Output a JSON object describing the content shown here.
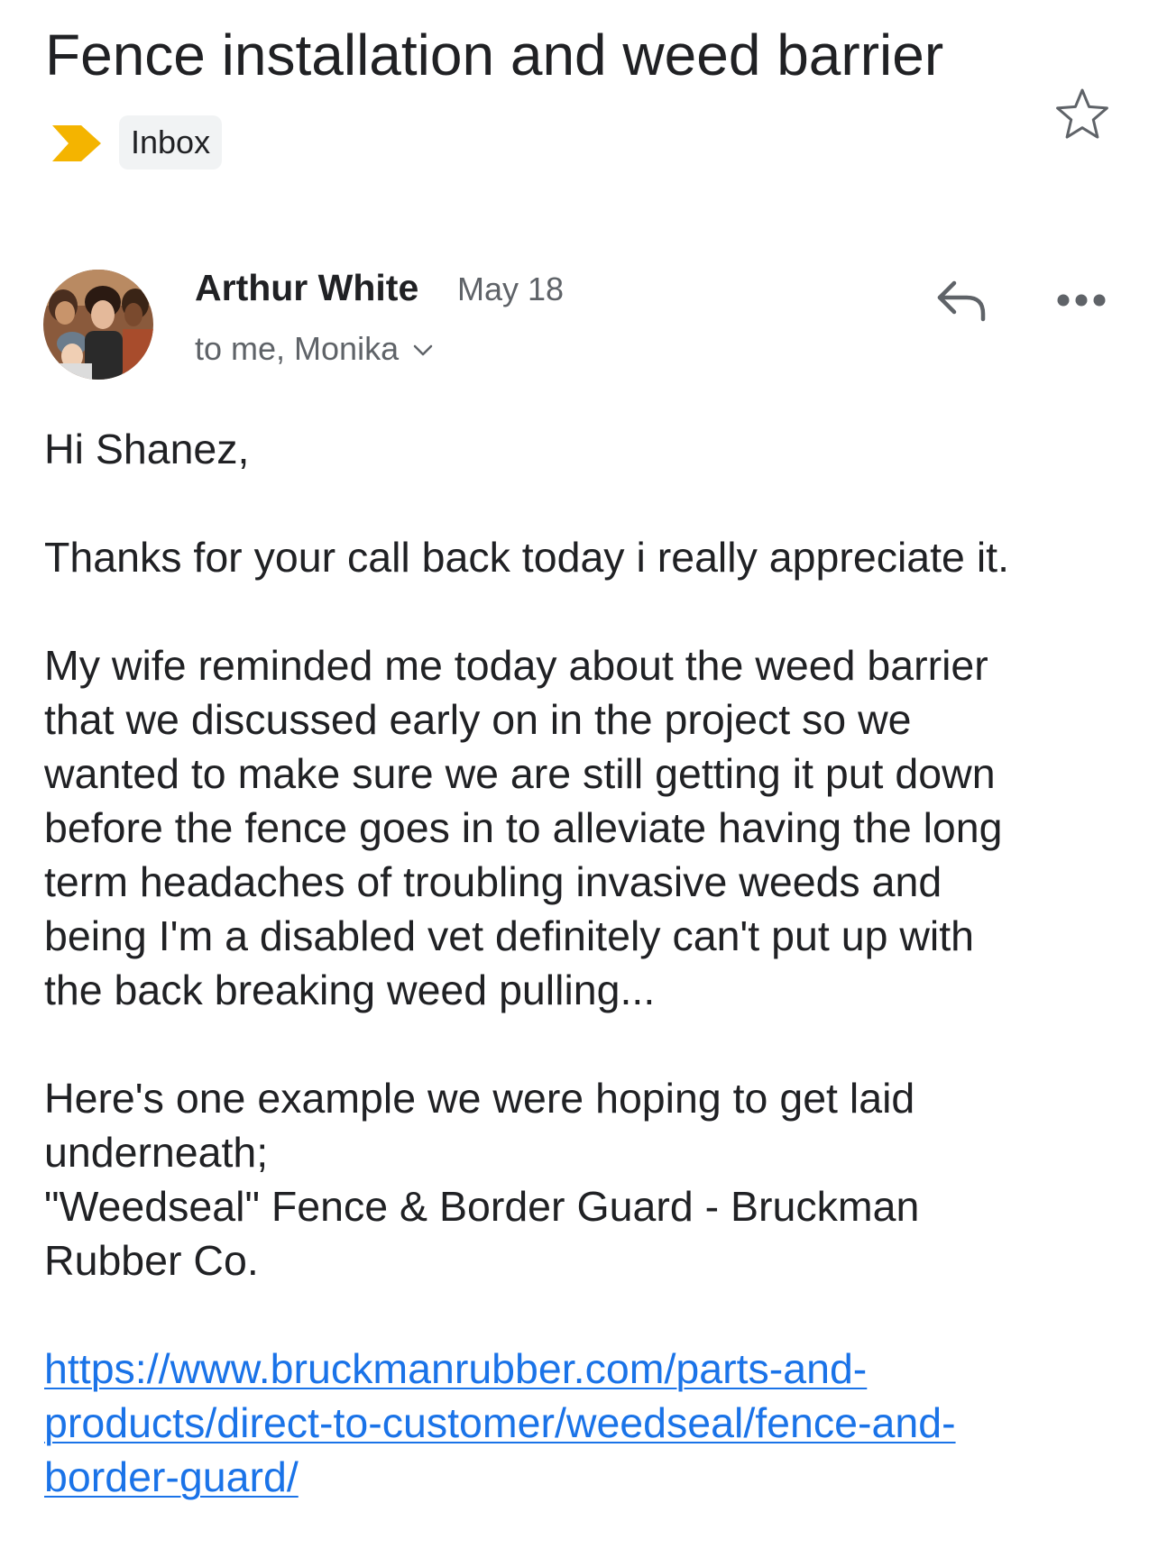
{
  "email": {
    "subject": "Fence installation and weed barrier",
    "label": "Inbox",
    "starred": false
  },
  "sender": {
    "name": "Arthur White",
    "date": "May 18",
    "recipients": "to me, Monika"
  },
  "body": {
    "greeting": "Hi Shanez,",
    "thanks": "Thanks for your call back today i really appreciate it.",
    "para2": [
      "My wife reminded me today about the weed barrier",
      "that we discussed early on in the project so we",
      "wanted to make sure we are still getting it put down",
      "before the fence goes in to alleviate having the long",
      "term headaches of troubling invasive weeds and",
      "being I'm a disabled vet definitely can't put up with",
      "the back breaking weed pulling..."
    ],
    "para3": [
      "Here's one example we were hoping to get laid",
      "underneath;",
      "\"Weedseal\" Fence & Border Guard - Bruckman",
      "Rubber Co."
    ],
    "link_lines": [
      "https://www.bruckmanrubber.com/parts-and-",
      "products/direct-to-customer/weedseal/fence-and-",
      "border-guard/"
    ]
  },
  "colors": {
    "importance_marker": "#f4b400",
    "link": "#1a73e8",
    "secondary_text": "#5f6368",
    "chip_bg": "#f1f3f4"
  },
  "icons": {
    "importance": "importance-marker-icon",
    "star": "star-outline-icon",
    "reply": "reply-arrow-icon",
    "more": "more-horizontal-icon",
    "recipients_toggle": "chevron-down-icon"
  }
}
